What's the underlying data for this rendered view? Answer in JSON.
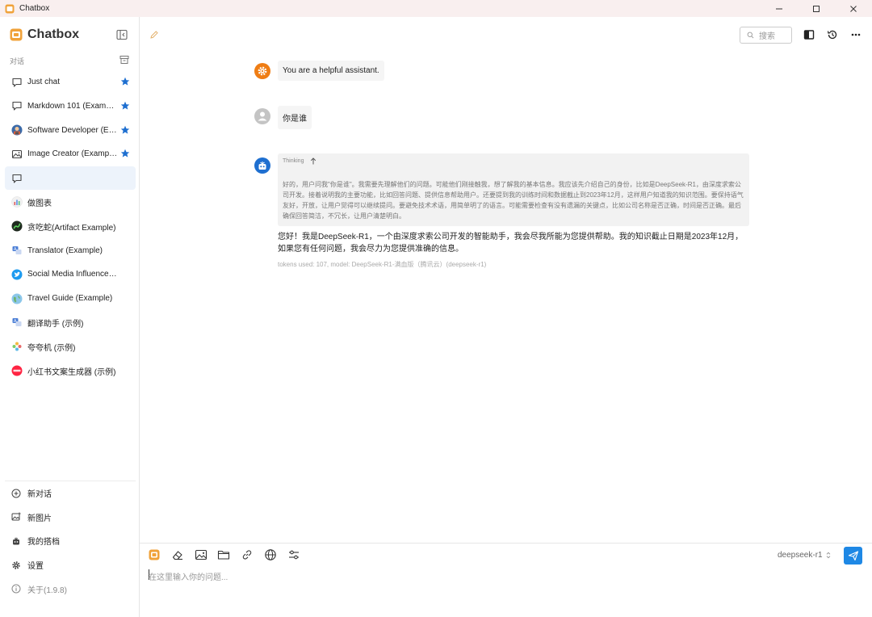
{
  "window": {
    "title": "Chatbox"
  },
  "sidebar": {
    "brand": "Chatbox",
    "section_label": "对话",
    "items": [
      {
        "label": "Just chat",
        "starred": true,
        "icon": "chat-bubble-icon"
      },
      {
        "label": "Markdown 101 (Example)",
        "starred": true,
        "icon": "chat-bubble-icon"
      },
      {
        "label": "Software Developer (Example)",
        "starred": true,
        "icon": "developer-avatar-icon"
      },
      {
        "label": "Image Creator (Example)",
        "starred": true,
        "icon": "image-icon"
      },
      {
        "label": "",
        "starred": false,
        "icon": "chat-bubble-icon",
        "active": true
      },
      {
        "label": "做图表",
        "starred": false,
        "icon": "chart-avatar-icon"
      },
      {
        "label": "贪吃蛇(Artifact Example)",
        "starred": false,
        "icon": "snake-avatar-icon"
      },
      {
        "label": "Translator (Example)",
        "starred": false,
        "icon": "translator-avatar-icon"
      },
      {
        "label": "Social Media Influencer (Example)",
        "starred": false,
        "icon": "twitter-avatar-icon"
      },
      {
        "label": "Travel Guide (Example)",
        "starred": false,
        "icon": "globe-avatar-icon"
      },
      {
        "label": "翻译助手 (示例)",
        "starred": false,
        "icon": "translator-avatar-icon"
      },
      {
        "label": "夸夸机 (示例)",
        "starred": false,
        "icon": "flower-avatar-icon"
      },
      {
        "label": "小红书文案生成器 (示例)",
        "starred": false,
        "icon": "xiaohongshu-avatar-icon"
      }
    ],
    "bottom": {
      "new_chat": "新对话",
      "new_image": "新图片",
      "my_partners": "我的搭档",
      "settings": "设置",
      "about": "关于(1.9.8)"
    }
  },
  "header": {
    "search_placeholder": "搜索"
  },
  "messages": {
    "system": "You are a helpful assistant.",
    "user": "你是谁",
    "thinking_label": "Thinking",
    "thinking_text": "好的，用户问我\"你是谁\"。我需要先理解他们的问题。可能他们刚接触我，想了解我的基本信息。我应该先介绍自己的身份，比如是DeepSeek-R1，由深度求索公司开发。接着说明我的主要功能，比如回答问题、提供信息帮助用户。还要提到我的训练时间和数据截止到2023年12月，这样用户知道我的知识范围。要保持语气友好，开放，让用户觉得可以继续提问。要避免技术术语，用简单明了的语言。可能需要检查有没有遗漏的关键点，比如公司名称是否正确，时间是否正确。最后确保回答简洁，不冗长，让用户清楚明白。",
    "answer": "您好！我是DeepSeek-R1，一个由深度求索公司开发的智能助手，我会尽我所能为您提供帮助。我的知识截止日期是2023年12月，如果您有任何问题，我会尽力为您提供准确的信息。",
    "meta": "tokens used: 107, model: DeepSeek-R1-满血版（腾讯云）(deepseek-r1)"
  },
  "composer": {
    "model": "deepseek-r1",
    "placeholder": "在这里输入你的问题..."
  },
  "colors": {
    "accent": "#1e88e5",
    "star": "#1e6fd0",
    "system_avatar": "#ef7d14",
    "user_avatar": "#c4c4c4",
    "assistant_avatar": "#1e6fd0"
  }
}
